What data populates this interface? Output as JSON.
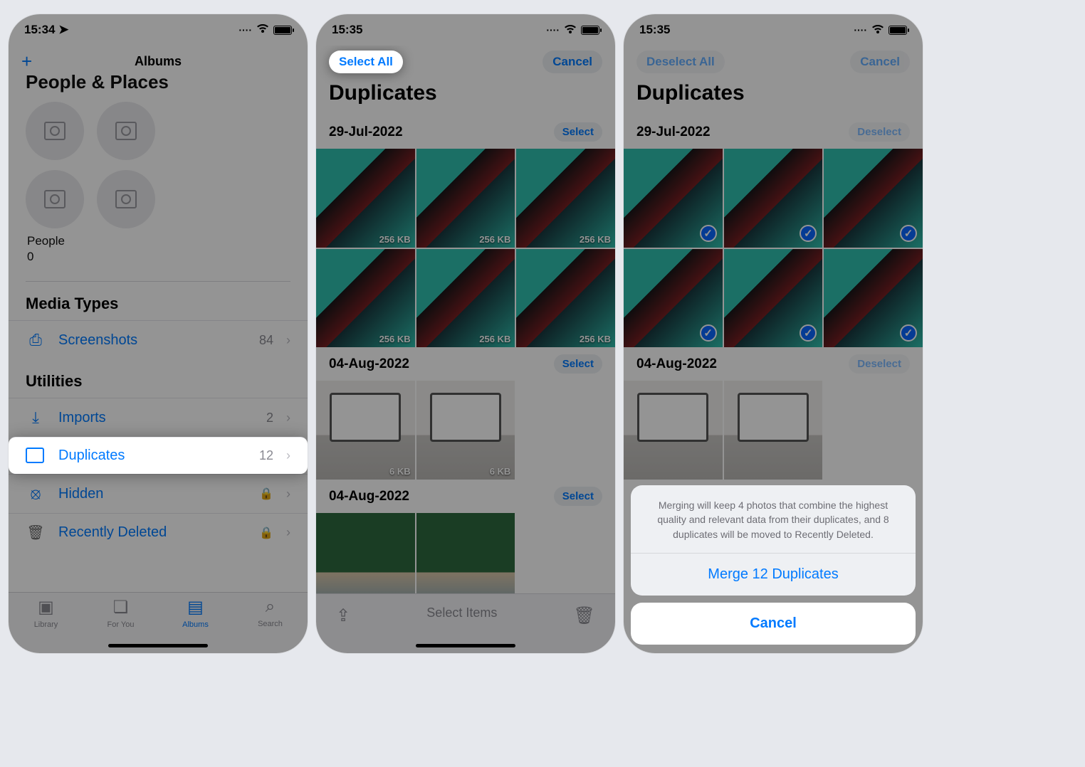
{
  "screenA": {
    "status_time": "15:34",
    "nav_title": "Albums",
    "people_places": "People & Places",
    "people_label": "People",
    "people_count": "0",
    "media_types": "Media Types",
    "screenshots_label": "Screenshots",
    "screenshots_count": "84",
    "utilities": "Utilities",
    "imports_label": "Imports",
    "imports_count": "2",
    "duplicates_label": "Duplicates",
    "duplicates_count": "12",
    "hidden_label": "Hidden",
    "recently_deleted_label": "Recently Deleted",
    "tabs": {
      "library": "Library",
      "foryou": "For You",
      "albums": "Albums",
      "search": "Search"
    }
  },
  "screenB": {
    "status_time": "15:35",
    "select_all": "Select All",
    "cancel": "Cancel",
    "title": "Duplicates",
    "group1_date": "29-Jul-2022",
    "group2_date": "04-Aug-2022",
    "group3_date": "04-Aug-2022",
    "select_label": "Select",
    "size_label": "256 KB",
    "size_label2": "6 KB",
    "footer_text": "Select Items"
  },
  "screenC": {
    "status_time": "15:35",
    "deselect_all": "Deselect All",
    "cancel": "Cancel",
    "title": "Duplicates",
    "group1_date": "29-Jul-2022",
    "group2_date": "04-Aug-2022",
    "deselect_label": "Deselect",
    "sheet_msg": "Merging will keep 4 photos that combine the highest quality and relevant data from their duplicates, and 8 duplicates will be moved to Recently Deleted.",
    "sheet_action": "Merge 12 Duplicates",
    "sheet_cancel": "Cancel"
  }
}
